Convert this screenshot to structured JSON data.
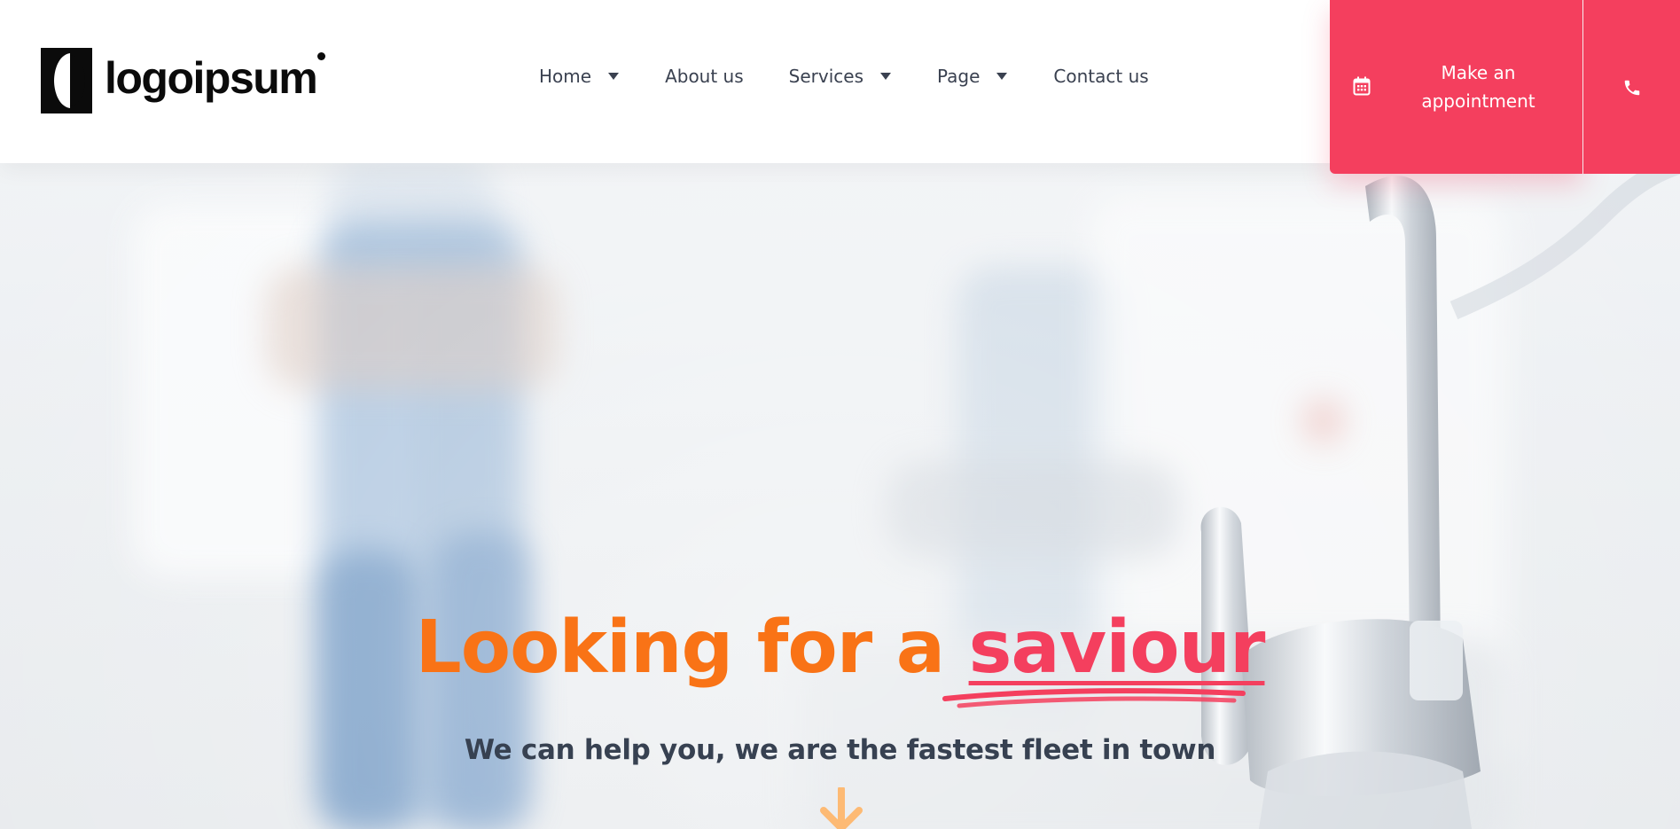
{
  "brand": {
    "logo_text": "logoipsum"
  },
  "nav": {
    "items": [
      {
        "label": "Home",
        "has_dropdown": true
      },
      {
        "label": "About us",
        "has_dropdown": false
      },
      {
        "label": "Services",
        "has_dropdown": true
      },
      {
        "label": "Page",
        "has_dropdown": true
      },
      {
        "label": "Contact us",
        "has_dropdown": false
      }
    ]
  },
  "cta": {
    "appointment_label": "Make an appointment",
    "appointment_icon": "calendar-icon",
    "phone_icon": "phone-icon"
  },
  "hero": {
    "headline_main": "Looking for a ",
    "headline_accent": "saviour",
    "subline": "We can help you, we are the fastest fleet in town",
    "scroll_icon": "arrow-down-icon"
  },
  "colors": {
    "accent": "#f43f5e",
    "headline": "#f97316",
    "text_dark": "#374151",
    "nav_text": "#3a4150"
  }
}
